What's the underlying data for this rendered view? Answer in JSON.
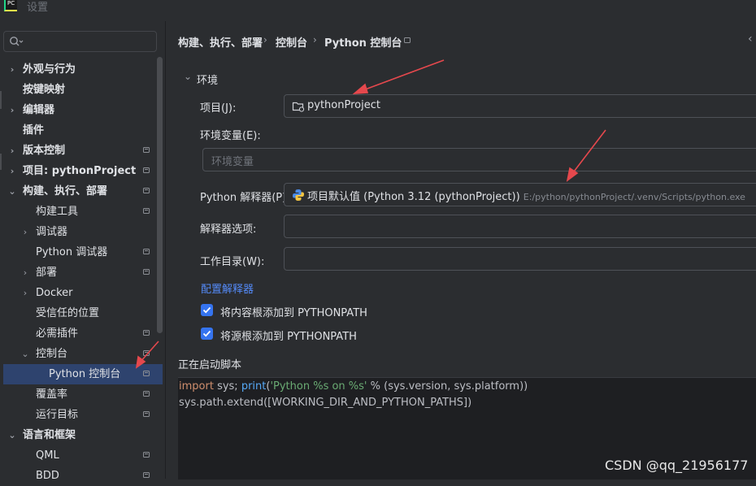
{
  "window": {
    "title": "设置",
    "app_logo": "PC"
  },
  "search": {
    "placeholder": ""
  },
  "sidebar": {
    "items": [
      {
        "label": "外观与行为",
        "chevron": "›",
        "bold": true
      },
      {
        "label": "按键映射",
        "bold": true
      },
      {
        "label": "编辑器",
        "chevron": "›",
        "bold": true
      },
      {
        "label": "插件",
        "bold": true
      },
      {
        "label": "版本控制",
        "chevron": "›",
        "bold": true
      },
      {
        "label": "项目: pythonProject",
        "chevron": "›",
        "bold": true
      },
      {
        "label": "构建、执行、部署",
        "chevron": "⌄",
        "bold": true
      },
      {
        "label": "构建工具"
      },
      {
        "label": "调试器",
        "chevron": "›"
      },
      {
        "label": "Python 调试器"
      },
      {
        "label": "部署",
        "chevron": "›"
      },
      {
        "label": "Docker",
        "chevron": "›"
      },
      {
        "label": "受信任的位置"
      },
      {
        "label": "必需插件"
      },
      {
        "label": "控制台",
        "chevron": "⌄"
      },
      {
        "label": "Python 控制台",
        "selected": true
      },
      {
        "label": "覆盖率"
      },
      {
        "label": "运行目标"
      },
      {
        "label": "语言和框架",
        "chevron": "⌄",
        "bold": true
      },
      {
        "label": "QML"
      },
      {
        "label": "BDD"
      }
    ]
  },
  "breadcrumb": {
    "part1": "构建、执行、部署",
    "sep": "›",
    "part2": "控制台",
    "part3": "Python 控制台"
  },
  "env": {
    "section_title": "环境",
    "collapse_glyph": "⌄",
    "project_label": "项目(J):",
    "project_value": "pythonProject",
    "env_vars_label": "环境变量(E):",
    "env_vars_placeholder": "环境变量",
    "interpreter_label": "Python 解释器(P):",
    "interpreter_value": "项目默认值 (Python 3.12 (pythonProject))",
    "interpreter_path": "E:/python/pythonProject/.venv/Scripts/python.exe",
    "interpreter_options_label": "解释器选项:",
    "interpreter_options_value": "",
    "workdir_label": "工作目录(W):",
    "workdir_value": "",
    "configure_link": "配置解释器",
    "checkbox1": "将内容根添加到 PYTHONPATH",
    "checkbox2": "将源根添加到 PYTHONPATH"
  },
  "startup": {
    "label": "正在启动脚本",
    "line1": {
      "kw": "import",
      "mid": " sys; ",
      "fn": "print",
      "open": "(",
      "str": "'Python %s on %s'",
      "rest": " % (sys.version, sys.platform))"
    },
    "line2": "sys.path.extend([WORKING_DIR_AND_PYTHON_PATHS])"
  },
  "watermark": "CSDN @qq_21956177",
  "colors": {
    "accent": "#3574f0",
    "link": "#548af7",
    "selection": "#2e436e",
    "annotation_arrow": "#e5484d"
  },
  "icons": {
    "back": "back-arrow-icon",
    "folder": "folder-icon",
    "python": "python-icon"
  }
}
